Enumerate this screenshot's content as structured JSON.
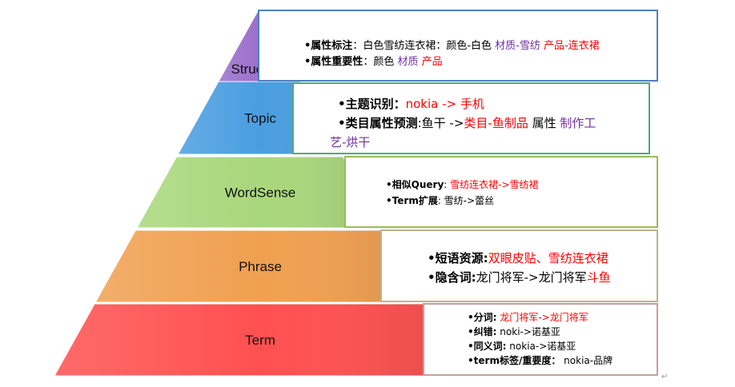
{
  "levels": [
    {
      "label": "Structure",
      "color": "#9b6fcb",
      "lines": [
        [
          {
            "t": "•属性标注",
            "s": "b"
          },
          {
            "t": "：白色雪纺连衣裙：颜色-白色 ",
            "s": ""
          },
          {
            "t": "材质-雪纺 ",
            "s": "purple"
          },
          {
            "t": "产品-连衣裙",
            "s": "red"
          }
        ],
        [
          {
            "t": "•属性重要性",
            "s": "b"
          },
          {
            "t": "：颜色 ",
            "s": ""
          },
          {
            "t": "材质 ",
            "s": "purple"
          },
          {
            "t": "产品",
            "s": "red"
          }
        ]
      ]
    },
    {
      "label": "Topic",
      "color": "#4a9ee0",
      "lines": [
        [
          {
            "t": "•主题识别：",
            "s": "b"
          },
          {
            "t": "nokia -> 手机",
            "s": "red"
          }
        ],
        [
          {
            "t": "•类目属性预测",
            "s": "b"
          },
          {
            "t": ":鱼干 ->",
            "s": ""
          },
          {
            "t": "类目-鱼制品",
            "s": "red"
          },
          {
            "t": " 属性 ",
            "s": ""
          },
          {
            "t": "制作工",
            "s": "purple"
          }
        ],
        [
          {
            "t": "艺-烘干",
            "s": "purple"
          }
        ]
      ]
    },
    {
      "label": "WordSense",
      "color": "#a9d77c",
      "lines": [
        [
          {
            "t": "•相似Query",
            "s": "b"
          },
          {
            "t": ": ",
            "s": ""
          },
          {
            "t": "雪纺连衣裙->雪纺裙",
            "s": "red"
          }
        ],
        [
          {
            "t": "•Term扩展",
            "s": "b"
          },
          {
            "t": ": 雪纺->蕾丝",
            "s": ""
          }
        ]
      ]
    },
    {
      "label": "Phrase",
      "color": "#f0a050",
      "lines": [
        [
          {
            "t": "•短语资源:",
            "s": "b"
          },
          {
            "t": "双眼皮贴、雪纺连衣裙",
            "s": "red"
          }
        ],
        [
          {
            "t": "•隐含词:",
            "s": "b"
          },
          {
            "t": "龙门将军->龙门将军",
            "s": ""
          },
          {
            "t": "斗鱼",
            "s": "red"
          }
        ]
      ]
    },
    {
      "label": "Term",
      "color": "#ff5050",
      "lines": [
        [
          {
            "t": "•分词:",
            "s": "b"
          },
          {
            "t": " 龙门将军->龙门将军",
            "s": "red"
          }
        ],
        [
          {
            "t": "•纠错:",
            "s": "b"
          },
          {
            "t": " noki->诺基亚",
            "s": ""
          }
        ],
        [
          {
            "t": "•同义词:",
            "s": "b"
          },
          {
            "t": " nokia->诺基亚",
            "s": ""
          }
        ],
        [
          {
            "t": "•term标签/重要度：",
            "s": "b"
          },
          {
            "t": " nokia-品牌",
            "s": ""
          }
        ]
      ]
    }
  ],
  "paragraph_mark": "↵"
}
